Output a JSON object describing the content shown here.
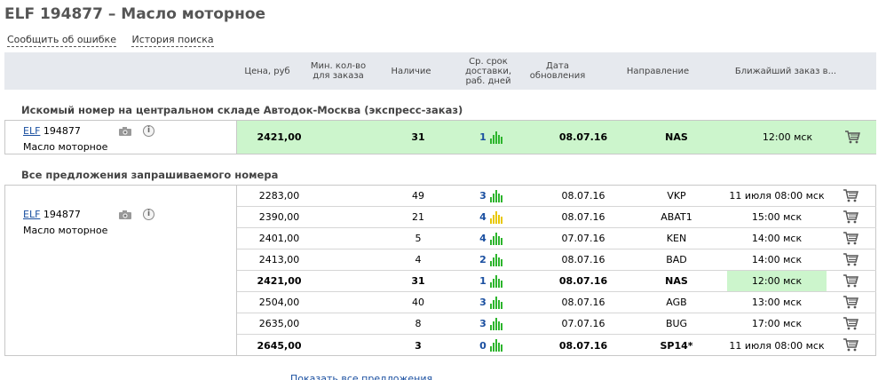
{
  "page": {
    "title": "ELF 194877 – Масло моторное",
    "links": {
      "report_error": "Сообщить об ошибке",
      "search_history": "История поиска"
    }
  },
  "columns": {
    "price": "Цена, руб",
    "min_qty": "Мин. кол-во для заказа",
    "stock": "Наличие",
    "delivery": "Ср. срок доставки, раб. дней",
    "updated": "Дата обновления",
    "direction": "Направление",
    "nearest_order": "Ближайший заказ в..."
  },
  "central": {
    "section_title": "Искомый номер на центральном складе Автодок-Москва (экспресс-заказ)",
    "brand": "ELF",
    "number": "194877",
    "description": "Масло моторное",
    "offer": {
      "price": "2421,00",
      "min_qty": "",
      "stock": "31",
      "days": "1",
      "date": "08.07.16",
      "direction": "NAS",
      "nearest": "12:00 мск"
    }
  },
  "all_offers": {
    "section_title": "Все предложения запрашиваемого номера",
    "brand": "ELF",
    "number": "194877",
    "description": "Масло моторное",
    "rows": [
      {
        "price": "2283,00",
        "stock": "49",
        "days": "3",
        "bar_color": "green",
        "date": "08.07.16",
        "direction": "VKP",
        "nearest": "11 июля 08:00 мск",
        "bold": false,
        "highlight": false
      },
      {
        "price": "2390,00",
        "stock": "21",
        "days": "4",
        "bar_color": "yellow",
        "date": "08.07.16",
        "direction": "ABAT1",
        "nearest": "15:00 мск",
        "bold": false,
        "highlight": false
      },
      {
        "price": "2401,00",
        "stock": "5",
        "days": "4",
        "bar_color": "green",
        "date": "07.07.16",
        "direction": "KEN",
        "nearest": "14:00 мск",
        "bold": false,
        "highlight": false
      },
      {
        "price": "2413,00",
        "stock": "4",
        "days": "2",
        "bar_color": "green",
        "date": "08.07.16",
        "direction": "BAD",
        "nearest": "14:00 мск",
        "bold": false,
        "highlight": false
      },
      {
        "price": "2421,00",
        "stock": "31",
        "days": "1",
        "bar_color": "green",
        "date": "08.07.16",
        "direction": "NAS",
        "nearest": "12:00 мск",
        "bold": true,
        "highlight": true
      },
      {
        "price": "2504,00",
        "stock": "40",
        "days": "3",
        "bar_color": "green",
        "date": "08.07.16",
        "direction": "AGB",
        "nearest": "13:00 мск",
        "bold": false,
        "highlight": false
      },
      {
        "price": "2635,00",
        "stock": "8",
        "days": "3",
        "bar_color": "green",
        "date": "07.07.16",
        "direction": "BUG",
        "nearest": "17:00 мск",
        "bold": false,
        "highlight": false
      },
      {
        "price": "2645,00",
        "stock": "3",
        "days": "0",
        "bar_color": "green",
        "date": "08.07.16",
        "direction": "SP14*",
        "nearest": "11 июля 08:00 мск",
        "bold": true,
        "highlight": false
      }
    ]
  },
  "show_all": "Показать все предложения",
  "icons": {
    "camera": "camera-icon",
    "info": "info-icon",
    "cart": "cart-icon",
    "bars": "rating-bars-icon"
  },
  "colors": {
    "green_bar": "#2db52d",
    "yellow_bar": "#e8c800",
    "highlight": "#ccf5cc",
    "link": "#1a4fa0"
  }
}
